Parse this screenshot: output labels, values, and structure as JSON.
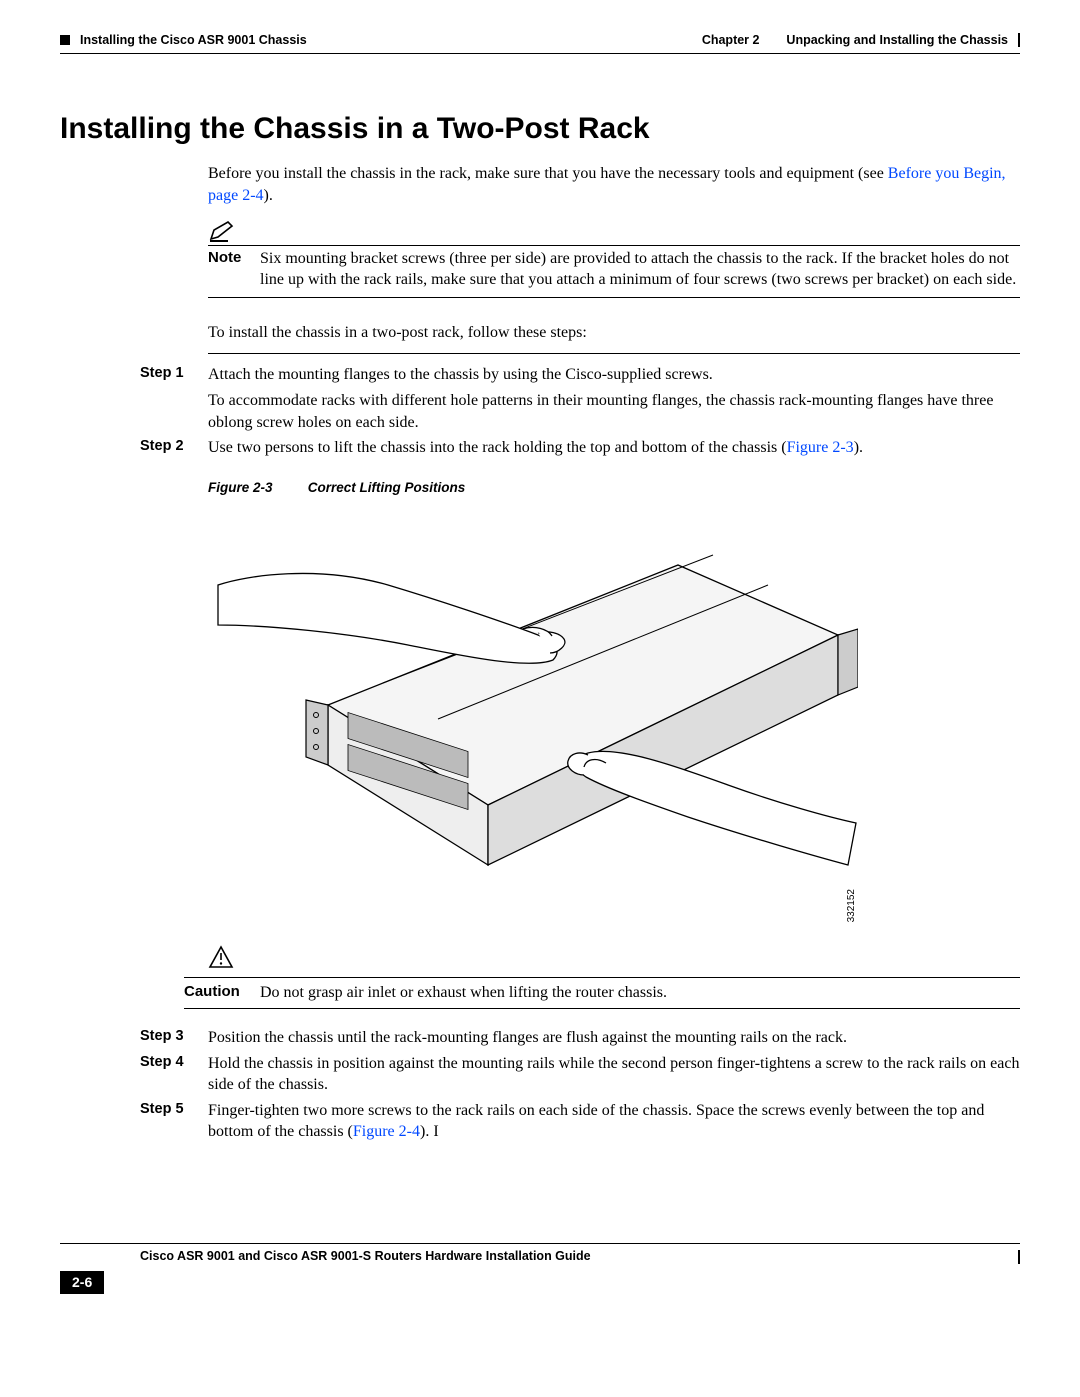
{
  "header": {
    "chapter_label": "Chapter 2",
    "chapter_title": "Unpacking and Installing the Chassis",
    "section_left": "Installing the Cisco ASR 9001 Chassis"
  },
  "heading": "Installing the Chassis in a Two-Post Rack",
  "intro": {
    "line1": "Before you install the chassis in the rack, make sure that you have the necessary tools and equipment (see ",
    "link1": "Before you Begin, page 2-4",
    "line1_tail": ")."
  },
  "note": {
    "label": "Note",
    "text": "Six mounting bracket screws (three per side) are provided to attach the chassis to the rack. If the bracket holes do not line up with the rack rails, make sure that you attach a minimum of four screws (two screws per bracket) on each side."
  },
  "mid_para": "To install the chassis in a two-post rack, follow these steps:",
  "steps_upper": [
    {
      "label": "Step 1",
      "text1": "Attach the mounting flanges to the chassis by using the Cisco-supplied screws.",
      "text2": "To accommodate racks with different hole patterns in their mounting flanges, the chassis rack-mounting flanges have three oblong screw holes on each side."
    },
    {
      "label": "Step 2",
      "text1_pre": "Use two persons to lift the chassis into the rack holding the top and bottom of the chassis (",
      "link": "Figure 2-3",
      "text1_post": ")."
    }
  ],
  "figure": {
    "num": "Figure 2-3",
    "title": "Correct Lifting Positions",
    "id": "332152"
  },
  "caution": {
    "label": "Caution",
    "text": "Do not grasp air inlet or exhaust when lifting the router chassis."
  },
  "steps_lower": [
    {
      "label": "Step 3",
      "text": "Position the chassis until the rack-mounting flanges are flush against the mounting rails on the rack."
    },
    {
      "label": "Step 4",
      "text": "Hold the chassis in position against the mounting rails while the second person finger-tightens a screw to the rack rails on each side of the chassis."
    },
    {
      "label": "Step 5",
      "text_pre": "Finger-tighten two more screws to the rack rails on each side of the chassis. Space the screws evenly between the top and bottom of the chassis (",
      "link": "Figure 2-4",
      "text_post": "). I"
    }
  ],
  "footer": {
    "guide_title": "Cisco ASR 9001 and Cisco ASR 9001-S Routers Hardware Installation Guide",
    "page_num": "2-6"
  }
}
